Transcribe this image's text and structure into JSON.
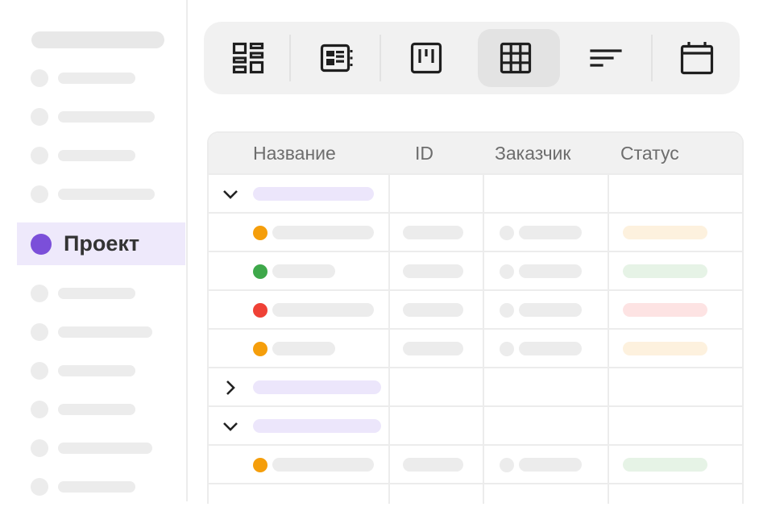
{
  "sidebar": {
    "active_item": {
      "label": "Проект",
      "color": "#7b4fd9"
    },
    "item_count": 11
  },
  "toolbar": {
    "views": [
      {
        "icon": "dashboard-icon",
        "active": false
      },
      {
        "icon": "board-view-icon",
        "active": false
      },
      {
        "icon": "kanban-icon",
        "active": false
      },
      {
        "icon": "table-grid-icon",
        "active": true
      },
      {
        "icon": "sort-list-icon",
        "active": false
      },
      {
        "icon": "calendar-icon",
        "active": false
      }
    ]
  },
  "table": {
    "columns": [
      "Название",
      "ID",
      "Заказчик",
      "Статус"
    ],
    "rows": [
      {
        "type": "group",
        "expanded": true
      },
      {
        "type": "item",
        "status_color": "#f59e0b",
        "status_pill": "#fdf1de"
      },
      {
        "type": "item",
        "status_color": "#3ea84a",
        "status_pill": "#e6f3e6"
      },
      {
        "type": "item",
        "status_color": "#ef4136",
        "status_pill": "#fde3e3"
      },
      {
        "type": "item",
        "status_color": "#f59e0b",
        "status_pill": "#fdf1de"
      },
      {
        "type": "group",
        "expanded": false
      },
      {
        "type": "group",
        "expanded": true
      },
      {
        "type": "item",
        "status_color": "#f59e0b",
        "status_pill": "#e6f3e6"
      }
    ]
  }
}
